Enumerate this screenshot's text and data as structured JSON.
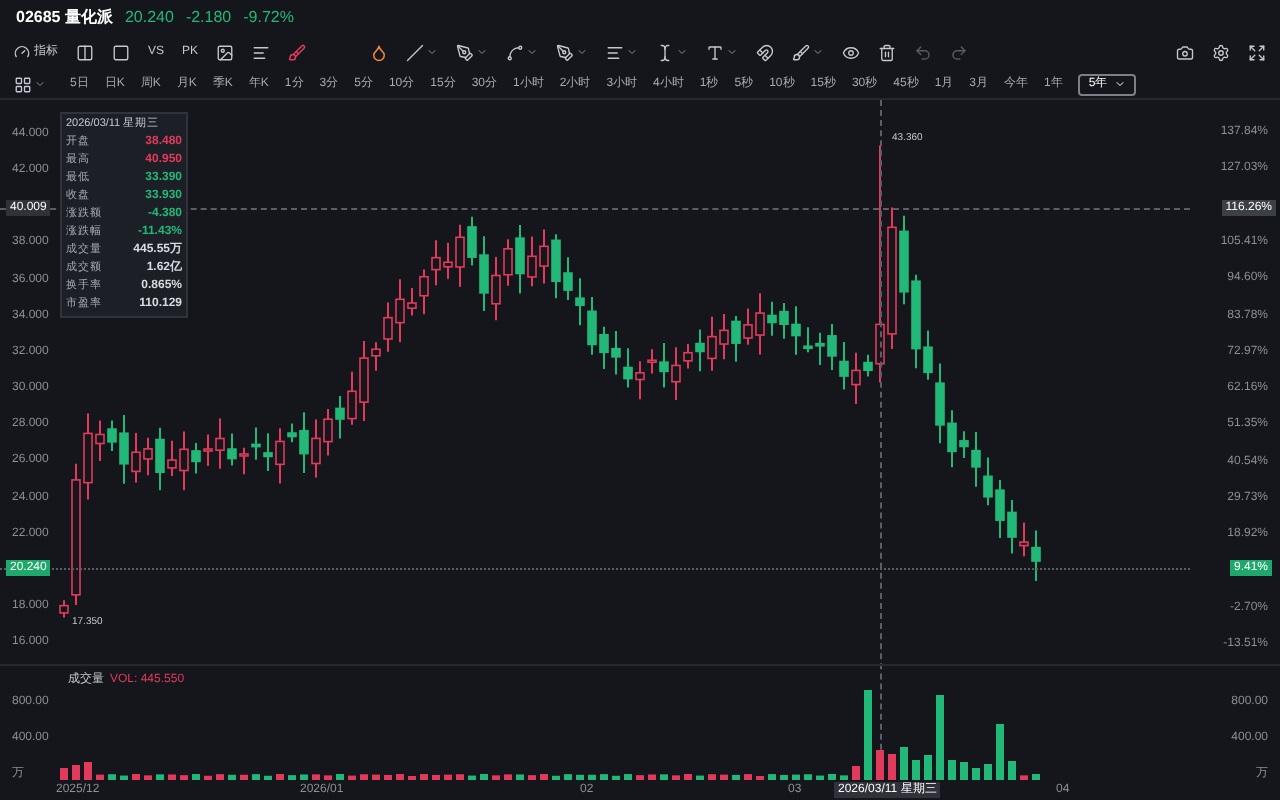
{
  "header": {
    "code": "02685",
    "name": "量化派",
    "price": "20.240",
    "change": "-2.180",
    "change_pct": "-9.72%"
  },
  "toolbar": {
    "indicator_label": "指标",
    "compare_labels": [
      "VS",
      "PK"
    ]
  },
  "periods": [
    {
      "label": "5日",
      "selected": false
    },
    {
      "label": "日K",
      "selected": false
    },
    {
      "label": "周K",
      "selected": false
    },
    {
      "label": "月K",
      "selected": false
    },
    {
      "label": "季K",
      "selected": false
    },
    {
      "label": "年K",
      "selected": false
    },
    {
      "label": "1分",
      "selected": false
    },
    {
      "label": "3分",
      "selected": false
    },
    {
      "label": "5分",
      "selected": false
    },
    {
      "label": "10分",
      "selected": false
    },
    {
      "label": "15分",
      "selected": false
    },
    {
      "label": "30分",
      "selected": false
    },
    {
      "label": "1小时",
      "selected": false
    },
    {
      "label": "2小时",
      "selected": false
    },
    {
      "label": "3小时",
      "selected": false
    },
    {
      "label": "4小时",
      "selected": false
    },
    {
      "label": "1秒",
      "selected": false
    },
    {
      "label": "5秒",
      "selected": false
    },
    {
      "label": "10秒",
      "selected": false
    },
    {
      "label": "15秒",
      "selected": false
    },
    {
      "label": "30秒",
      "selected": false
    },
    {
      "label": "45秒",
      "selected": false
    },
    {
      "label": "1月",
      "selected": false
    },
    {
      "label": "3月",
      "selected": false
    },
    {
      "label": "今年",
      "selected": false
    },
    {
      "label": "1年",
      "selected": false
    },
    {
      "label": "5年",
      "selected": true
    }
  ],
  "chart": {
    "left_ticks": [
      [
        "44.000",
        "42.000"
      ],
      [
        "38.000",
        "36.000",
        "34.000",
        "32.000",
        "30.000",
        "28.000",
        "26.000",
        "24.000",
        "22.000"
      ],
      [
        "18.000",
        "16.000"
      ]
    ],
    "right_ticks": [
      [
        "137.84%",
        "127.03%"
      ],
      [
        "105.41%",
        "94.60%",
        "83.78%",
        "72.97%",
        "62.16%",
        "51.35%",
        "40.54%",
        "29.73%",
        "18.92%"
      ],
      [
        "-2.70%",
        "-13.51%"
      ]
    ],
    "high_label": "43.360",
    "low_label": "17.350",
    "crosshair": {
      "price": "40.009",
      "pct": "116.26%",
      "date": "2026/03/11 星期三"
    },
    "last": {
      "price": "20.240",
      "pct": "9.41%"
    },
    "x_labels": [
      "2025/12",
      "2026/01",
      "02",
      "03",
      "04"
    ]
  },
  "tooltip": {
    "date": "2026/03/11 星期三",
    "rows": [
      {
        "label": "开盘",
        "value": "38.480",
        "color": "#e23a5b"
      },
      {
        "label": "最高",
        "value": "40.950",
        "color": "#e23a5b"
      },
      {
        "label": "最低",
        "value": "33.390",
        "color": "#22b878"
      },
      {
        "label": "收盘",
        "value": "33.930",
        "color": "#22b878"
      },
      {
        "label": "涨跌额",
        "value": "-4.380",
        "color": "#22b878"
      },
      {
        "label": "涨跌幅",
        "value": "-11.43%",
        "color": "#22b878"
      },
      {
        "label": "成交量",
        "value": "445.55万",
        "color": "#d8dbe0"
      },
      {
        "label": "成交额",
        "value": "1.62亿",
        "color": "#d8dbe0"
      },
      {
        "label": "换手率",
        "value": "0.865%",
        "color": "#d8dbe0"
      },
      {
        "label": "市盈率",
        "value": "110.129",
        "color": "#d8dbe0"
      }
    ]
  },
  "volume": {
    "title": "成交量",
    "reading": "VOL: 445.550",
    "left_ticks": [
      "800.00",
      "400.00",
      "万"
    ],
    "right_ticks": [
      "800.00",
      "400.00",
      "万"
    ]
  }
}
